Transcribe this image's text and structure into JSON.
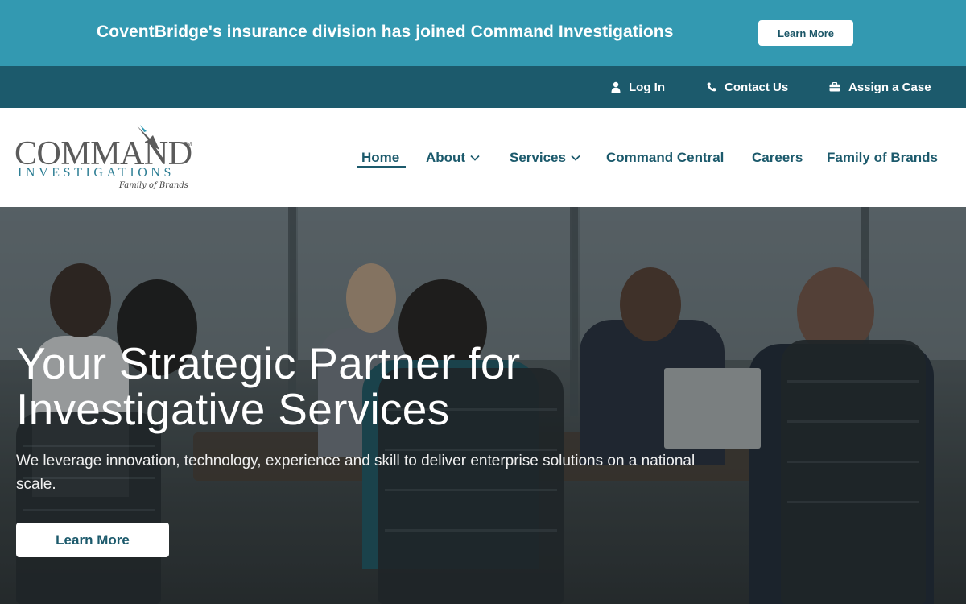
{
  "announcement": {
    "text": "CoventBridge's insurance division has joined Command Investigations",
    "button_label": "Learn More"
  },
  "utility_nav": {
    "items": [
      {
        "label": "Log In",
        "icon": "user-icon"
      },
      {
        "label": "Contact Us",
        "icon": "phone-icon"
      },
      {
        "label": "Assign a Case",
        "icon": "briefcase-icon"
      }
    ]
  },
  "logo": {
    "word": "COMMAND",
    "tm": "TM",
    "sub": "INVESTIGATIONS",
    "tagline": "Family of Brands"
  },
  "main_nav": {
    "items": [
      {
        "label": "Home",
        "active": true,
        "has_dropdown": false
      },
      {
        "label": "About",
        "active": false,
        "has_dropdown": true
      },
      {
        "label": "Services",
        "active": false,
        "has_dropdown": true
      },
      {
        "label": "Command Central",
        "active": false,
        "has_dropdown": false
      },
      {
        "label": "Careers",
        "active": false,
        "has_dropdown": false
      },
      {
        "label": "Family of Brands",
        "active": false,
        "has_dropdown": false
      }
    ]
  },
  "hero": {
    "title": "Your Strategic Partner for Investigative Services",
    "subtitle": "We leverage innovation, technology, experience and skill to deliver enterprise solutions on a national scale.",
    "button_label": "Learn More"
  },
  "colors": {
    "announcement_bg": "#3399b1",
    "utility_bg": "#1c5a6c",
    "nav_text": "#1c5a6c",
    "brand_teal": "#2f7f95",
    "button_bg": "#ffffff"
  }
}
